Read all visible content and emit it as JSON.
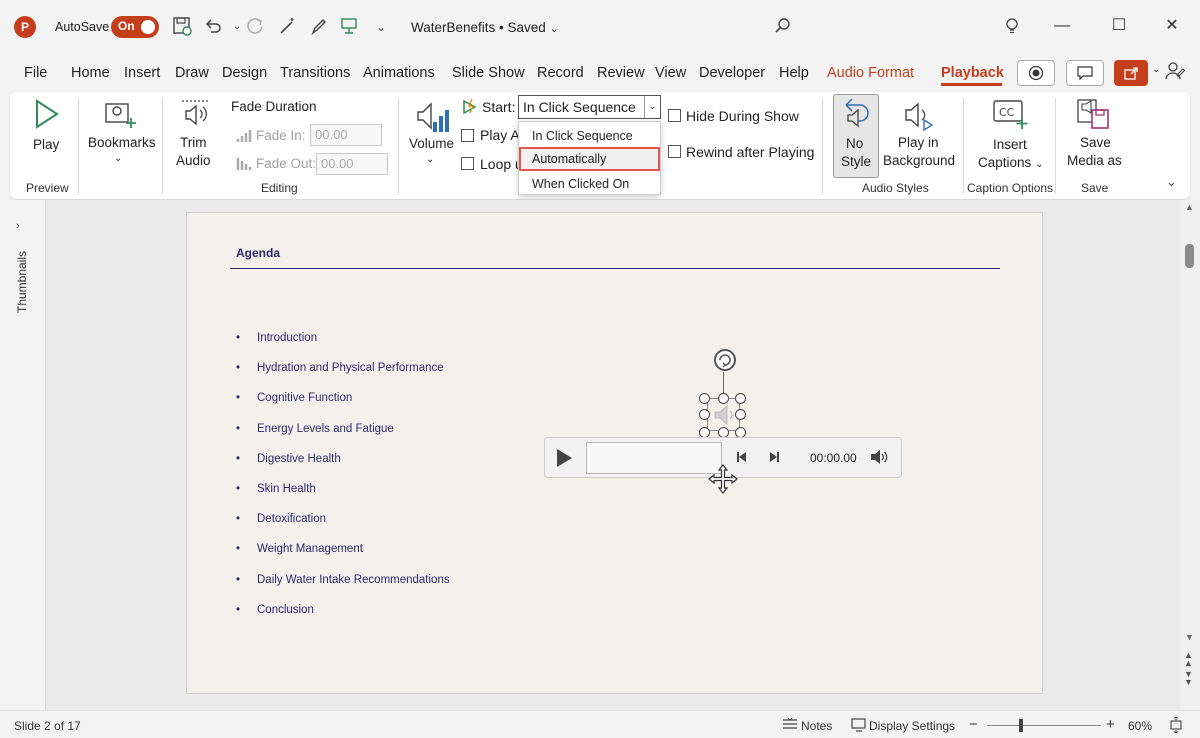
{
  "titlebar": {
    "app_icon": "P",
    "autosave_label": "AutoSave",
    "autosave_state": "On",
    "doc_title": "WaterBenefits • Saved",
    "icons": [
      "save-icon",
      "undo-icon",
      "redo-icon",
      "customize-qat-icon",
      "search-icon",
      "lightbulb-icon",
      "minimize-icon",
      "maximize-icon",
      "close-icon"
    ]
  },
  "tabs": [
    "File",
    "Home",
    "Insert",
    "Draw",
    "Design",
    "Transitions",
    "Animations",
    "Slide Show",
    "Record",
    "Review",
    "View",
    "Developer",
    "Help",
    "Audio Format",
    "Playback"
  ],
  "ribbon": {
    "preview": {
      "play": "Play",
      "group": "Preview"
    },
    "bookmarks": {
      "label": "Bookmarks"
    },
    "editing": {
      "trim_line1": "Trim",
      "trim_line2": "Audio",
      "fade_duration": "Fade Duration",
      "fade_in_label": "Fade In:",
      "fade_in_value": "00.00",
      "fade_out_label": "Fade Out:",
      "fade_out_value": "00.00",
      "group": "Editing"
    },
    "audio_options": {
      "volume": "Volume",
      "start_label": "Start:",
      "start_value": "In Click Sequence",
      "play_across": "Play A",
      "loop": "Loop u",
      "hide_during_show": "Hide During Show",
      "rewind_after_playing": "Rewind after Playing",
      "dropdown_options": [
        "In Click Sequence",
        "Automatically",
        "When Clicked On"
      ],
      "highlighted_option": "Automatically"
    },
    "audio_styles": {
      "no_style_line1": "No",
      "no_style_line2": "Style",
      "play_bg_line1": "Play in",
      "play_bg_line2": "Background",
      "group": "Audio Styles"
    },
    "caption_options": {
      "line1": "Insert",
      "line2": "Captions",
      "group": "Caption Options"
    },
    "save": {
      "line1": "Save",
      "line2": "Media as",
      "group": "Save"
    }
  },
  "sidepane": {
    "label": "Thumbnails"
  },
  "slide": {
    "title": "Agenda",
    "bullets": [
      "Introduction",
      "Hydration and Physical Performance",
      "Cognitive Function",
      "Energy Levels and Fatigue",
      "Digestive Health",
      "Skin Health",
      "Detoxification",
      "Weight Management",
      "Daily Water Intake Recommendations",
      "Conclusion"
    ],
    "bullet_char": "•"
  },
  "player": {
    "time": "00:00.00"
  },
  "statusbar": {
    "slide_info": "Slide 2 of 17",
    "notes": "Notes",
    "display_settings": "Display Settings",
    "zoom_minus": "−",
    "zoom_plus": "+",
    "zoom": "60%"
  },
  "colors": {
    "accent": "#c43e1c",
    "slide_text": "#2b2a6d",
    "highlight_border": "#e0584b"
  }
}
